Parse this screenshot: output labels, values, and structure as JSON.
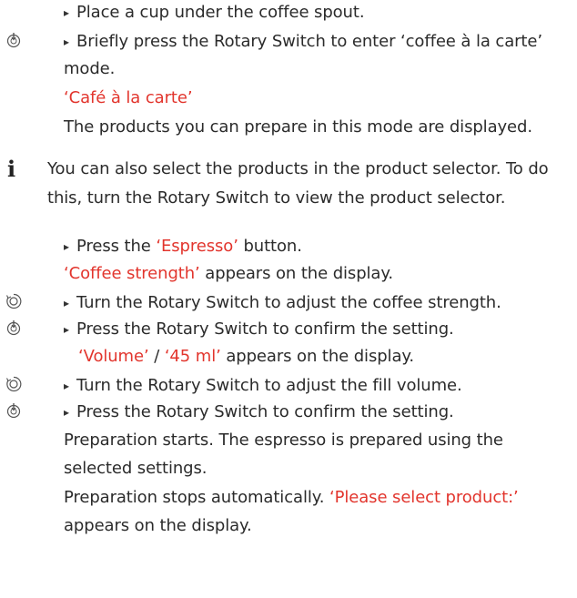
{
  "steps": {
    "s1": "Place a cup under the coffee spout.",
    "s2a": "Briefly press the Rotary Switch to enter ‘coffee à la carte’",
    "s2b": "mode.",
    "s2_display": "‘Café à la carte’",
    "s2_note": "The products you can prepare in this mode are displayed.",
    "tip_a": "You can also select the products in the product selector. To do",
    "tip_b": "this, turn the Rotary Switch to view the product selector.",
    "s3_pre": "Press the ",
    "s3_btn": "‘Espresso’",
    "s3_post": " button.",
    "s3_display": "‘Coffee strength’",
    "s3_display_post": " appears on the display.",
    "s4": "Turn the Rotary Switch to adjust the coffee strength.",
    "s5": "Press the Rotary Switch to confirm the setting.",
    "s5_display_a": "‘Volume’",
    "s5_sep": " / ",
    "s5_display_b": "‘45 ml’",
    "s5_display_post": " appears on the display.",
    "s6": "Turn the Rotary Switch to adjust the fill volume.",
    "s7": "Press the Rotary Switch to confirm the setting.",
    "r1a": "Preparation starts. The espresso is prepared using the",
    "r1b": "selected settings.",
    "r2a_pre": "Preparation stops automatically. ",
    "r2a_display": "‘Please select product:’",
    "r2b": "appears on the display."
  },
  "icons": {
    "press": "rotary-press-icon",
    "turn": "rotary-turn-icon",
    "info": "info-icon"
  },
  "colors": {
    "display_text": "#e2352d",
    "body_text": "#2b2b2b"
  }
}
